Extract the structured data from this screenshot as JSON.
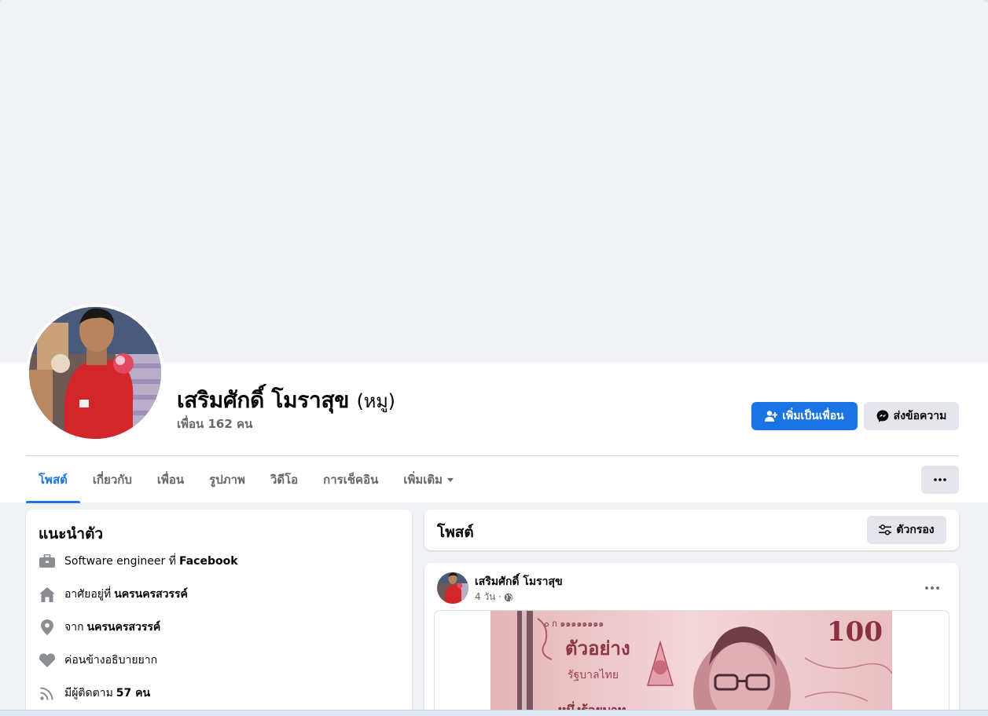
{
  "profile": {
    "name": "เสริมศักดิ์ โมราสุข",
    "alternate_name": "(หมู)",
    "friends_count": "เพื่อน 162 คน"
  },
  "actions": {
    "add_friend": "เพิ่มเป็นเพื่อน",
    "message": "ส่งข้อความ"
  },
  "tabs": [
    {
      "label": "โพสต์",
      "active": true
    },
    {
      "label": "เกี่ยวกับ",
      "active": false
    },
    {
      "label": "เพื่อน",
      "active": false
    },
    {
      "label": "รูปภาพ",
      "active": false
    },
    {
      "label": "วิดีโอ",
      "active": false
    },
    {
      "label": "การเช็คอิน",
      "active": false
    },
    {
      "label": "เพิ่มเติม",
      "active": false
    }
  ],
  "intro": {
    "title": "แนะนำตัว",
    "items": [
      {
        "icon": "briefcase-icon",
        "text": "Software engineer ที่",
        "bold": "Facebook"
      },
      {
        "icon": "home-icon",
        "text": "อาศัยอยู่ที่",
        "bold": "นครนครสวรรค์"
      },
      {
        "icon": "location-pin-icon",
        "text": "จาก",
        "bold": "นครนครสวรรค์"
      },
      {
        "icon": "heart-icon",
        "text": "ค่อนข้างอธิบายยาก",
        "bold": ""
      },
      {
        "icon": "rss-icon",
        "text": "มีผู้ติดตาม",
        "bold": "57 คน"
      }
    ]
  },
  "posts": {
    "title": "โพสต์",
    "filter_label": "ตัวกรอง"
  },
  "post": {
    "author": "เสริมศักดิ์ โมราสุข",
    "time": "4 วัน ·",
    "image": {
      "serial": "๐ ก ๑๑๑๑๑๑๑๑",
      "denomination": "100",
      "specimen_text": "ตัวอย่าง",
      "bank_text": "รัฐบาลไทย",
      "value_text": "หนึ่งร้อยบาท"
    }
  },
  "colors": {
    "accent": "#1b74e4",
    "secondary_text": "#65676b",
    "button_gray": "#e4e6eb"
  }
}
